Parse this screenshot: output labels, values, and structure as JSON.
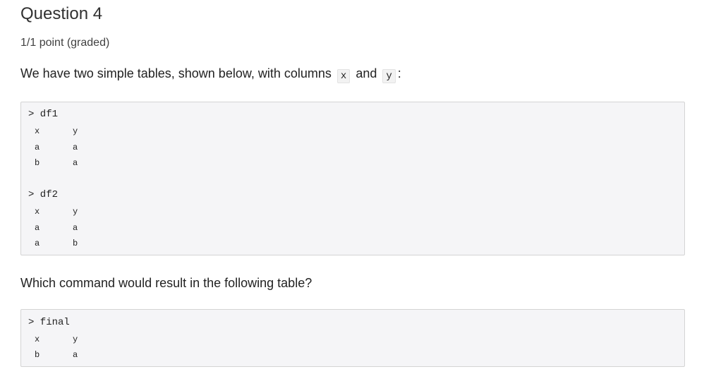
{
  "question": {
    "title": "Question 4",
    "points": "1/1 point (graded)",
    "intro": {
      "before": "We have two simple tables, shown below, with columns",
      "code_x": "x",
      "between": "and",
      "code_y": "y",
      "after": ":"
    },
    "prompt_text": "Which command would result in the following table?"
  },
  "tables": {
    "df1": {
      "command": "> df1",
      "header": [
        "x",
        "y"
      ],
      "rows": [
        [
          "a",
          "a"
        ],
        [
          "b",
          "a"
        ]
      ]
    },
    "df2": {
      "command": "> df2",
      "header": [
        "x",
        "y"
      ],
      "rows": [
        [
          "a",
          "a"
        ],
        [
          "a",
          "b"
        ]
      ]
    },
    "final": {
      "command": "> final",
      "header": [
        "x",
        "y"
      ],
      "rows": [
        [
          "b",
          "a"
        ]
      ]
    }
  }
}
